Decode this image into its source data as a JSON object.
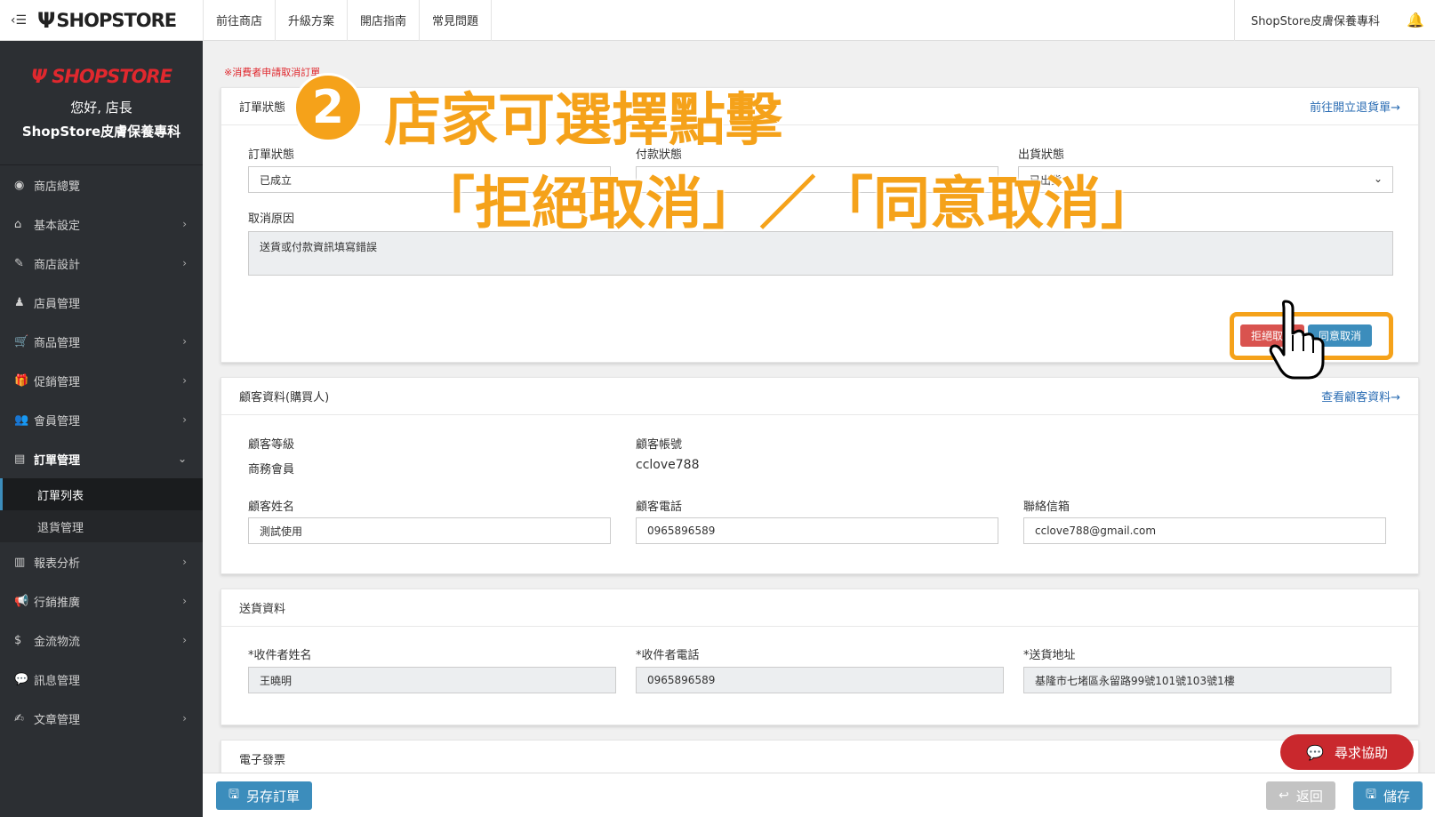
{
  "topbar": {
    "logo": "SHOPSTORE",
    "nav": [
      "前往商店",
      "升級方案",
      "開店指南",
      "常見問題"
    ],
    "store_name": "ShopStore皮膚保養專科"
  },
  "sidebar": {
    "logo": "SHOPSTORE",
    "greeting": "您好, 店長",
    "store_name": "ShopStore皮膚保養專科",
    "items": [
      {
        "label": "商店總覽"
      },
      {
        "label": "基本設定"
      },
      {
        "label": "商店設計"
      },
      {
        "label": "店員管理"
      },
      {
        "label": "商品管理"
      },
      {
        "label": "促銷管理"
      },
      {
        "label": "會員管理"
      },
      {
        "label": "訂單管理"
      },
      {
        "label": "報表分析"
      },
      {
        "label": "行銷推廣"
      },
      {
        "label": "金流物流"
      },
      {
        "label": "訊息管理"
      },
      {
        "label": "文章管理"
      }
    ],
    "sub_items": [
      "訂單列表",
      "退貨管理"
    ]
  },
  "notice": "※消費者申請取消訂單",
  "order_status": {
    "title": "訂單狀態",
    "link": "前往開立退貨單→",
    "order_status_label": "訂單狀態",
    "order_status_value": "已成立",
    "payment_status_label": "付款狀態",
    "shipping_status_label": "出貨狀態",
    "shipping_status_value": "已出貨",
    "cancel_reason_label": "取消原因",
    "cancel_reason_value": "送貨或付款資訊填寫錯誤",
    "reject_button": "拒絕取消",
    "agree_button": "同意取消"
  },
  "customer": {
    "title": "顧客資料(購買人)",
    "link": "查看顧客資料→",
    "level_label": "顧客等級",
    "level_value": "商務會員",
    "account_label": "顧客帳號",
    "account_value": "cclove788",
    "name_label": "顧客姓名",
    "name_value": "測試使用",
    "phone_label": "顧客電話",
    "phone_value": "0965896589",
    "email_label": "聯絡信箱",
    "email_value": "cclove788@gmail.com"
  },
  "shipping": {
    "title": "送貨資料",
    "recipient_label": "*收件者姓名",
    "recipient_value": "王曉明",
    "recipient_phone_label": "*收件者電話",
    "recipient_phone_value": "0965896589",
    "address_label": "*送貨地址",
    "address_value": "基隆市七堵區永留路99號101號103號1樓"
  },
  "invoice": {
    "title": "電子發票"
  },
  "annotation": {
    "step": "2",
    "line1": "店家可選擇點擊",
    "line2": "「拒絕取消」／「同意取消」"
  },
  "bottom": {
    "save_as": "另存訂單",
    "back": "返回",
    "save": "儲存"
  },
  "help_button": "尋求協助",
  "colors": {
    "sidebar_bg": "#2c2f33",
    "primary": "#3c8dbc",
    "danger": "#d9534f",
    "annotation": "#f5a21a",
    "help": "#c9282d"
  }
}
